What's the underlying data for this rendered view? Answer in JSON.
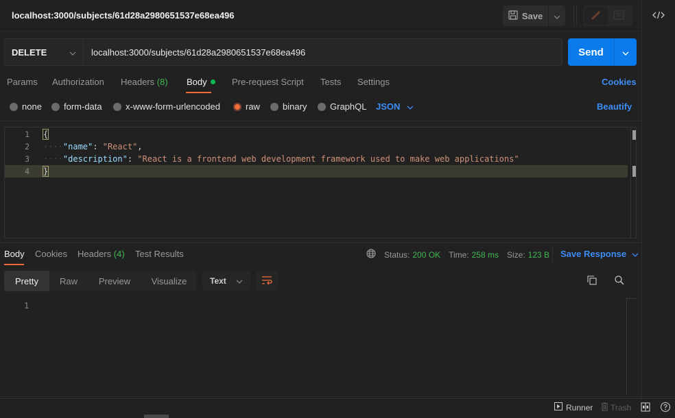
{
  "header": {
    "tab_title": "localhost:3000/subjects/61d28a2980651537e68ea496",
    "save_label": "Save",
    "icons": {
      "save": "floppy-disk-icon",
      "save_dropdown": "chevron-down-icon",
      "edit": "pencil-icon",
      "comments": "comment-icon",
      "code": "code-icon"
    }
  },
  "request": {
    "method": "DELETE",
    "url": "localhost:3000/subjects/61d28a2980651537e68ea496",
    "send_label": "Send",
    "tabs": [
      {
        "label": "Params"
      },
      {
        "label": "Authorization"
      },
      {
        "label": "Headers",
        "count": "(8)"
      },
      {
        "label": "Body",
        "active": true,
        "indicator": "green-dot"
      },
      {
        "label": "Pre-request Script"
      },
      {
        "label": "Tests"
      },
      {
        "label": "Settings"
      }
    ],
    "cookies_link": "Cookies",
    "body_types": [
      {
        "label": "none",
        "selected": false
      },
      {
        "label": "form-data",
        "selected": false
      },
      {
        "label": "x-www-form-urlencoded",
        "selected": false
      },
      {
        "label": "raw",
        "selected": true
      },
      {
        "label": "binary",
        "selected": false
      },
      {
        "label": "GraphQL",
        "selected": false
      }
    ],
    "format": "JSON",
    "beautify_label": "Beautify",
    "body_lines": [
      {
        "no": "1"
      },
      {
        "no": "2",
        "key": "\"name\"",
        "value": "\"React\""
      },
      {
        "no": "3",
        "key": "\"description\"",
        "value": "\"React is a frontend web development framework used to make web applications\""
      },
      {
        "no": "4"
      }
    ],
    "open_brace": "{",
    "close_brace": "}"
  },
  "response": {
    "tabs": [
      {
        "label": "Body",
        "active": true
      },
      {
        "label": "Cookies"
      },
      {
        "label": "Headers",
        "count": "(4)"
      },
      {
        "label": "Test Results"
      }
    ],
    "status_label": "Status:",
    "status_value": "200 OK",
    "time_label": "Time:",
    "time_value": "258 ms",
    "size_label": "Size:",
    "size_value": "123 B",
    "save_response_label": "Save Response",
    "views": [
      {
        "label": "Pretty",
        "active": true
      },
      {
        "label": "Raw"
      },
      {
        "label": "Preview"
      },
      {
        "label": "Visualize"
      }
    ],
    "text_format": "Text",
    "line_numbers": [
      "1"
    ]
  },
  "footer": {
    "runner_label": "Runner",
    "trash_label": "Trash"
  },
  "colors": {
    "accent_orange": "#f26b3a",
    "primary_blue": "#097bed",
    "link_blue": "#3d8df5",
    "success_green": "#3fb950"
  }
}
